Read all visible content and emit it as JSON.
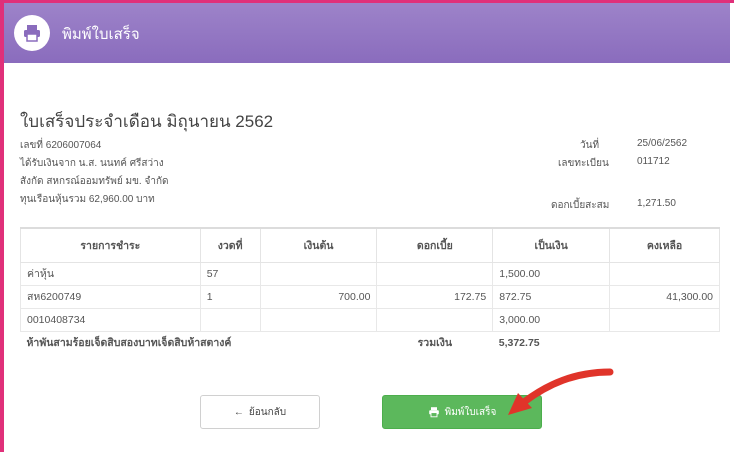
{
  "header": {
    "title": "พิมพ์ใบเสร็จ",
    "icon": "printer-icon"
  },
  "document": {
    "title": "ใบเสร็จประจำเดือน มิถุนายน 2562",
    "left_info": [
      "เลขที่ 6206007064",
      "ได้รับเงินจาก น.ส. นนทค์ ศรีสว่าง",
      "สังกัด สหกรณ์ออมทรัพย์ มข. จำกัด",
      "ทุนเรือนหุ้นรวม 62,960.00 บาท"
    ],
    "date_label": "วันที่",
    "date_value": "25/06/2562",
    "member_label": "เลขทะเบียน",
    "member_value": "011712",
    "interest_label": "ดอกเบี้ยสะสม",
    "interest_value": "1,271.50"
  },
  "table": {
    "headers": [
      "รายการชำระ",
      "งวดที่",
      "เงินต้น",
      "ดอกเบี้ย",
      "เป็นเงิน",
      "คงเหลือ"
    ],
    "rows": [
      [
        "ค่าหุ้น",
        "57",
        "",
        "",
        "1,500.00",
        ""
      ],
      [
        "สห6200749",
        "1",
        "700.00",
        "172.75",
        "872.75",
        "41,300.00"
      ],
      [
        "0010408734",
        "",
        "",
        "",
        "3,000.00",
        ""
      ]
    ],
    "total_text": "ห้าพันสามร้อยเจ็ดสิบสองบาทเจ็ดสิบห้าสตางค์",
    "total_label": "รวมเงิน",
    "total_value": "5,372.75"
  },
  "buttons": {
    "back_label": "ย้อนกลับ",
    "print_label": "พิมพ์ใบเสร็จ"
  },
  "colors": {
    "header": "#8a6cbd",
    "accent_border": "#e0307a",
    "print_button": "#5cb85c",
    "arrow": "#e0342a"
  }
}
